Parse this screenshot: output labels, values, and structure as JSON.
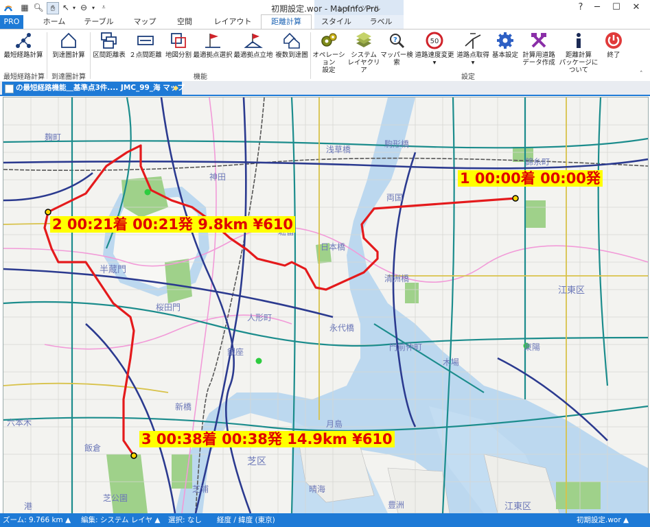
{
  "window": {
    "title": "初期設定.wor - MapInfo Pro",
    "context_group": "レイヤ ツール"
  },
  "tabs": [
    "PRO",
    "ホーム",
    "テーブル",
    "マップ",
    "空間",
    "レイアウト",
    "距離計算",
    "スタイル",
    "ラベル"
  ],
  "ribbon": {
    "buttons": [
      {
        "label1": "最短経路計算",
        "label2": ""
      },
      {
        "label1": "到達圏計算",
        "label2": ""
      },
      {
        "label1": "区間距離表",
        "label2": ""
      },
      {
        "label1": "２点間距離",
        "label2": ""
      },
      {
        "label1": "地図分割",
        "label2": ""
      },
      {
        "label1": "最適拠点選択",
        "label2": ""
      },
      {
        "label1": "最適拠点立地",
        "label2": ""
      },
      {
        "label1": "複数到達圏",
        "label2": ""
      },
      {
        "label1": "オペレーション",
        "label2": "設定"
      },
      {
        "label1": "システム",
        "label2": "レイヤクリア"
      },
      {
        "label1": "マッパー検索",
        "label2": ""
      },
      {
        "label1": "道路速度変更",
        "label2": "▾"
      },
      {
        "label1": "道路点取得",
        "label2": "▾"
      },
      {
        "label1": "基本設定",
        "label2": ""
      },
      {
        "label1": "計算用道路",
        "label2": "データ作成"
      },
      {
        "label1": "距離計算",
        "label2": "パッケージについて"
      },
      {
        "label1": "終了",
        "label2": ""
      }
    ],
    "groups": [
      "最短経路計算",
      "到達圏計算",
      "機能",
      "設定"
    ],
    "speed_sign": "50"
  },
  "document_tab": {
    "title": "の最短経路機能＿基準点3件.... JMC_99_海 マップ"
  },
  "map": {
    "route_labels": [
      "1 00:00着 00:00発",
      "2 00:21着 00:21発 9.8km ¥610",
      "3 00:38着 00:38発 14.9km ¥610"
    ],
    "place_names": [
      "神田",
      "浅草橋",
      "両国",
      "駒形橋",
      "錦糸町",
      "日本橋",
      "半蔵門",
      "桜田門",
      "永代橋",
      "月島",
      "晴海",
      "豊洲",
      "江東区",
      "東陽",
      "銀座",
      "新橋",
      "六本木",
      "飯倉",
      "芝公園",
      "芝浦",
      "芝区",
      "清洲橋",
      "人形町",
      "堀留",
      "江東区",
      "門前仲町",
      "木場",
      "麹町",
      "港"
    ],
    "colors": {
      "route": "#e41a1c",
      "label_bg": "#ffff00",
      "water": "#b8d8f2",
      "park": "#9fd18a",
      "primary_road": "#2b3a8f",
      "secondary_road": "#1b8c8c",
      "rail": "#f29ad8"
    }
  },
  "status_bar": {
    "zoom": "ズーム: 9.766 km ▲",
    "edit": "編集: システム レイヤ ▲",
    "select": "選択: なし",
    "coords": "経度 / 緯度 (東京)",
    "workspace": "初期設定.wor ▲"
  }
}
